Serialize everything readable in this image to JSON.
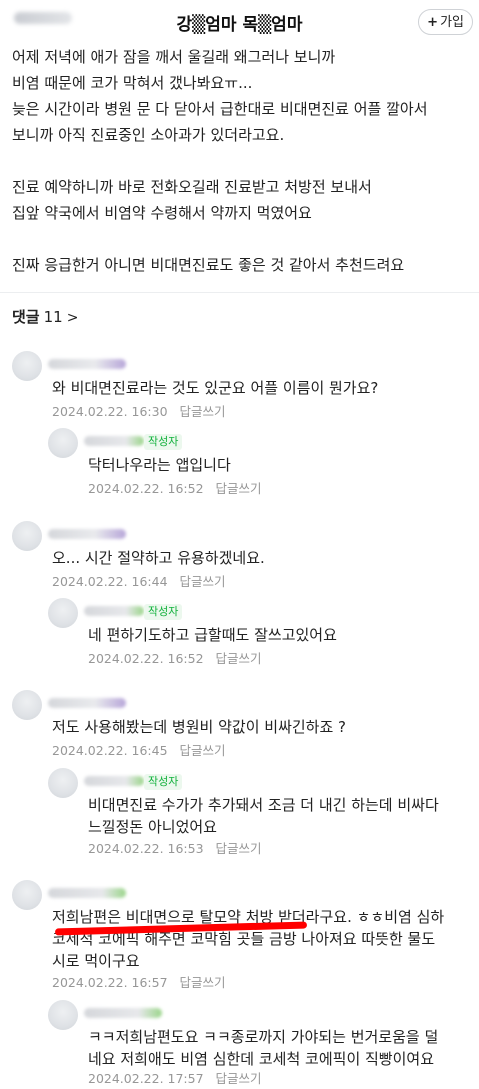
{
  "header": {
    "title": "강▒엄마 목▒엄마",
    "join_label": "가입",
    "join_plus": "+"
  },
  "post": {
    "lines": [
      "어제 저녁에 애가 잠을 깨서 울길래 왜그러나 보니까",
      "비염 때문에 코가 막혀서 갰나봐요ㅠ...",
      "늦은 시간이라 병원 문 다 닫아서 급한대로 비대면진료 어플 깔아서",
      "보니까 아직 진료중인 소아과가 있더라고요.",
      "",
      "진료 예약하니까 바로 전화오길래 진료받고 처방전 보내서",
      "집앞 약국에서 비염약 수령해서 약까지 먹였어요",
      "",
      "진짜 응급한거 아니면 비대면진료도 좋은 것 같아서 추천드려요"
    ]
  },
  "comments_header": {
    "label": "댓글",
    "count": "11",
    "chevron": ">"
  },
  "reply_label": "답글쓰기",
  "author_badge": "작성자",
  "comments": [
    {
      "lines": [
        "와 비대면진료라는 것도 있군요 어플 이름이 뭔가요?"
      ],
      "date": "2024.02.22. 16:30"
    },
    {
      "lines": [
        "닥터나우라는 앱입니다"
      ],
      "date": "2024.02.22. 16:52"
    },
    {
      "lines": [
        "오... 시간 절약하고 유용하겠네요."
      ],
      "date": "2024.02.22. 16:44"
    },
    {
      "lines": [
        "네 편하기도하고 급할때도 잘쓰고있어요"
      ],
      "date": "2024.02.22. 16:52"
    },
    {
      "lines": [
        "저도 사용해봤는데 병원비 약값이 비싸긴하죠 ?"
      ],
      "date": "2024.02.22. 16:45"
    },
    {
      "lines": [
        "비대면진료 수가가 추가돼서 조금 더 내긴 하는데 비싸다",
        "느낄정돈 아니었어요"
      ],
      "date": "2024.02.22. 16:53"
    },
    {
      "lines": [
        "저희남편은 비대면으로 탈모약 처방 받더라구요. ㅎㅎ비염 심하",
        "코세척 코에픽 해주면 코막힘 곳들 금방 나아져요 따뜻한 물도",
        "시로 먹이구요"
      ],
      "date": "2024.02.22. 16:57"
    },
    {
      "lines": [
        "ㅋㅋ저희남편도요 ㅋㅋ종로까지 가야되는 번거로움을 덜",
        "네요 저희애도 비염 심한데 코세척 코에픽이 직빵이여요"
      ],
      "date": "2024.02.22. 17:57"
    }
  ]
}
